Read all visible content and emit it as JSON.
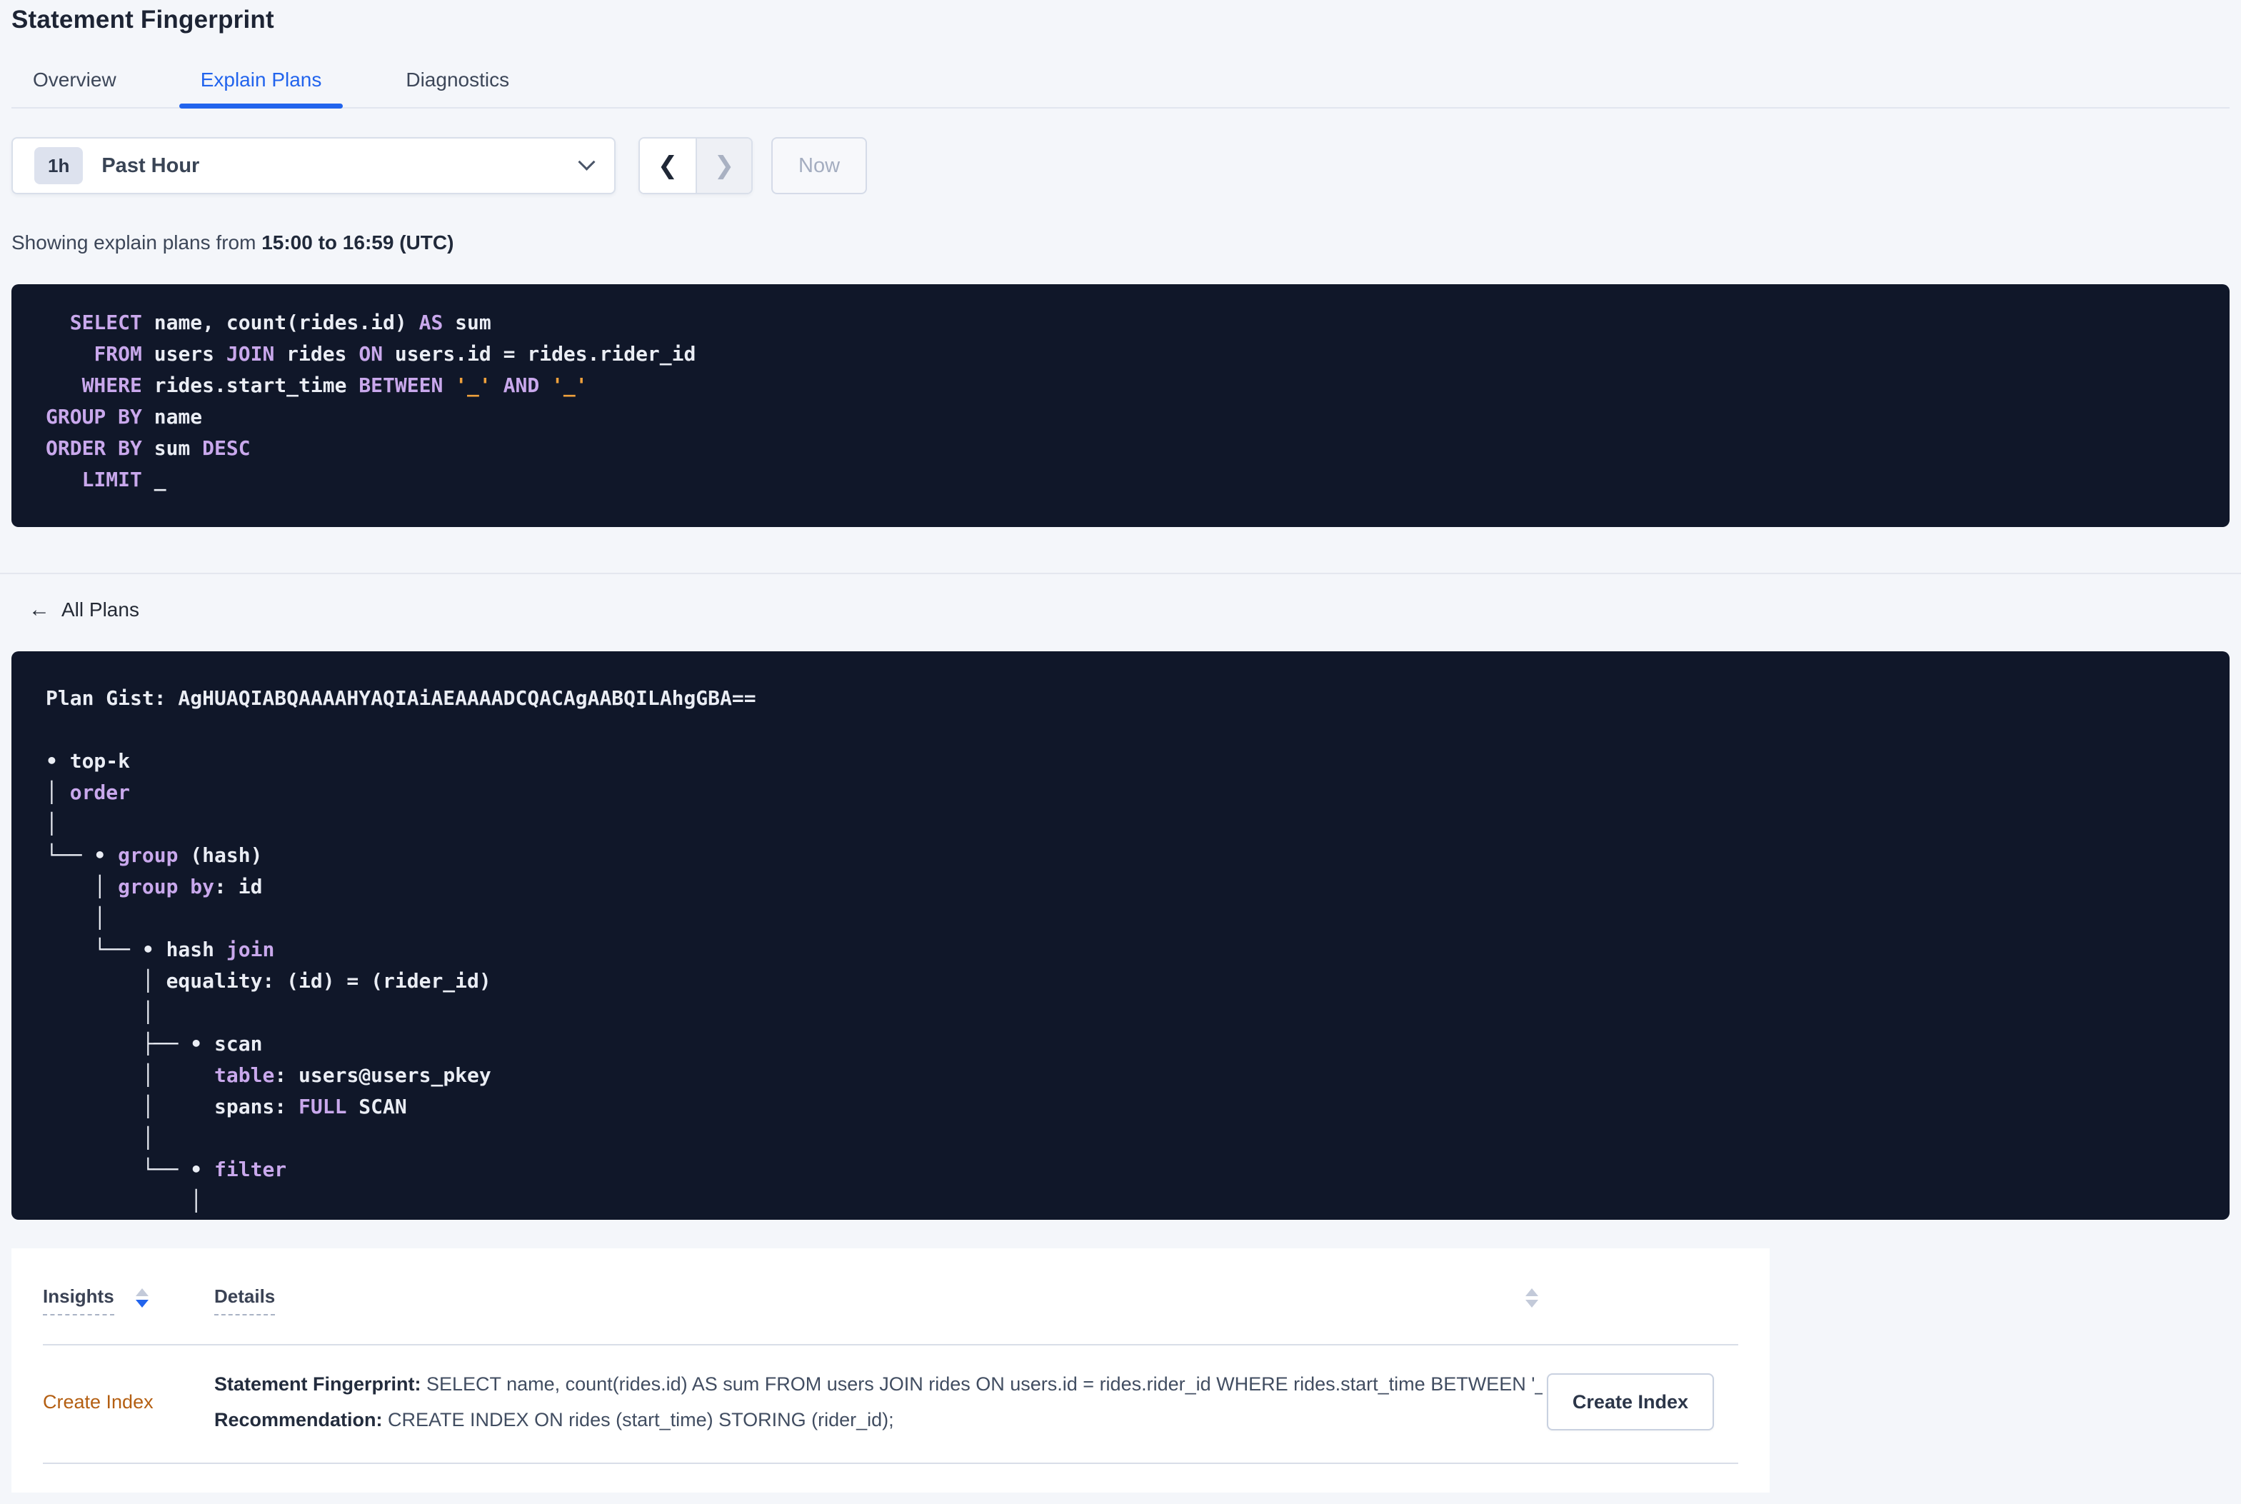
{
  "page": {
    "title": "Statement Fingerprint"
  },
  "tabs": {
    "items": [
      {
        "label": "Overview"
      },
      {
        "label": "Explain Plans"
      },
      {
        "label": "Diagnostics"
      }
    ],
    "active": "Explain Plans"
  },
  "time_selector": {
    "badge": "1h",
    "selected": "Past Hour",
    "prev_icon": "❮",
    "next_icon": "❯",
    "now_label": "Now"
  },
  "status_line": {
    "prefix": "Showing explain plans from ",
    "bold_range": "15:00 to 16:59 (UTC)"
  },
  "sql": {
    "lines": [
      [
        {
          "t": "  "
        },
        {
          "t": "SELECT",
          "c": "kw"
        },
        {
          "t": " name, count(rides.id) "
        },
        {
          "t": "AS",
          "c": "kw"
        },
        {
          "t": " sum"
        }
      ],
      [
        {
          "t": "    "
        },
        {
          "t": "FROM",
          "c": "kw"
        },
        {
          "t": " users "
        },
        {
          "t": "JOIN",
          "c": "kw"
        },
        {
          "t": " rides "
        },
        {
          "t": "ON",
          "c": "kw"
        },
        {
          "t": " users.id = rides.rider_id"
        }
      ],
      [
        {
          "t": "   "
        },
        {
          "t": "WHERE",
          "c": "kw"
        },
        {
          "t": " rides.start_time "
        },
        {
          "t": "BETWEEN",
          "c": "kw"
        },
        {
          "t": " "
        },
        {
          "t": "'_'",
          "c": "lit"
        },
        {
          "t": " "
        },
        {
          "t": "AND",
          "c": "kw"
        },
        {
          "t": " "
        },
        {
          "t": "'_'",
          "c": "lit"
        }
      ],
      [
        {
          "t": "GROUP BY",
          "c": "kw"
        },
        {
          "t": " name"
        }
      ],
      [
        {
          "t": "ORDER BY",
          "c": "kw"
        },
        {
          "t": " sum "
        },
        {
          "t": "DESC",
          "c": "kw"
        }
      ],
      [
        {
          "t": "   "
        },
        {
          "t": "LIMIT",
          "c": "kw"
        },
        {
          "t": " _"
        }
      ]
    ]
  },
  "back_link": {
    "arrow": "←",
    "label": "All Plans"
  },
  "plan": {
    "gist_line": "Plan Gist: AgHUAQIABQAAAAHYAQIAiAEAAAADCQACAgAABQILAhgGBA==",
    "tree": [
      [
        {
          "t": ""
        }
      ],
      [
        {
          "t": "• top-k"
        }
      ],
      [
        {
          "t": "│ "
        },
        {
          "t": "order",
          "c": "kw"
        }
      ],
      [
        {
          "t": "│"
        }
      ],
      [
        {
          "t": "└── • "
        },
        {
          "t": "group",
          "c": "kw"
        },
        {
          "t": " (hash)"
        }
      ],
      [
        {
          "t": "    │ "
        },
        {
          "t": "group by",
          "c": "kw"
        },
        {
          "t": ": id"
        }
      ],
      [
        {
          "t": "    │"
        }
      ],
      [
        {
          "t": "    └── • hash "
        },
        {
          "t": "join",
          "c": "kw"
        }
      ],
      [
        {
          "t": "        │ equality: (id) = (rider_id)"
        }
      ],
      [
        {
          "t": "        │"
        }
      ],
      [
        {
          "t": "        ├── • scan"
        }
      ],
      [
        {
          "t": "        │     "
        },
        {
          "t": "table",
          "c": "kw"
        },
        {
          "t": ": users@users_pkey"
        }
      ],
      [
        {
          "t": "        │     spans: "
        },
        {
          "t": "FULL",
          "c": "kw"
        },
        {
          "t": " SCAN"
        }
      ],
      [
        {
          "t": "        │"
        }
      ],
      [
        {
          "t": "        └── • "
        },
        {
          "t": "filter",
          "c": "kw"
        }
      ],
      [
        {
          "t": "            │"
        }
      ]
    ]
  },
  "insights_table": {
    "headers": [
      {
        "label": "Insights",
        "sort": "desc"
      },
      {
        "label": "Details",
        "sort": "none"
      }
    ],
    "row": {
      "insight": "Create Index",
      "fingerprint_label": "Statement Fingerprint:",
      "fingerprint_text": " SELECT name, count(rides.id) AS sum FROM users JOIN rides ON users.id = rides.rider_id WHERE rides.start_time BETWEEN '_…",
      "recommendation_label": "Recommendation:",
      "recommendation_text": " CREATE INDEX ON rides (start_time) STORING (rider_id);",
      "action_label": "Create Index"
    }
  },
  "colors": {
    "page_bg": "#f4f6fa",
    "panel_bg": "#101729",
    "accent_blue": "#2264ed",
    "keyword_purple": "#c9a8ec",
    "literal_orange": "#f0a13c",
    "insight_link_orange": "#b45f12",
    "border_gray": "#d9dfea"
  }
}
